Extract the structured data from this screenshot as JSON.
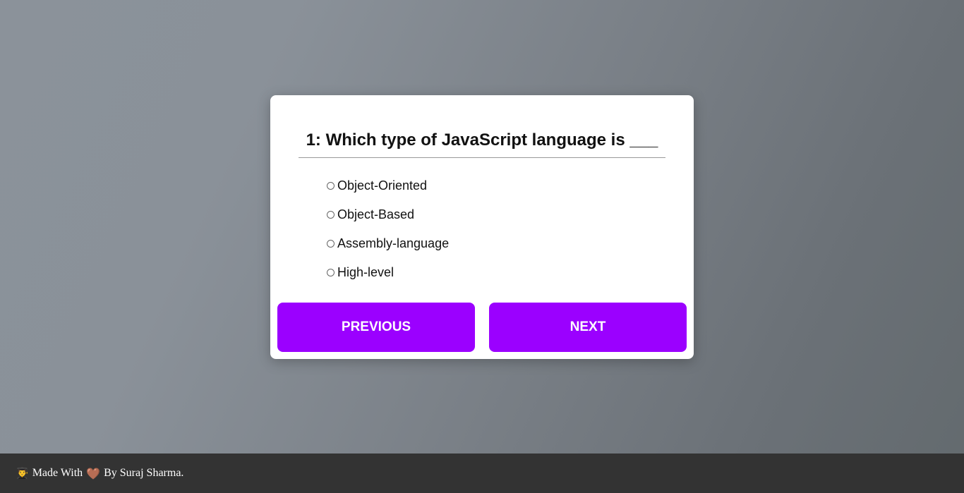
{
  "quiz": {
    "question": "1: Which type of JavaScript language is ___",
    "options": [
      "Object-Oriented",
      "Object-Based",
      "Assembly-language",
      "High-level"
    ],
    "previous_label": "PREVIOUS",
    "next_label": "NEXT"
  },
  "footer": {
    "emoji": "👨‍🎓",
    "made_with": "Made With",
    "heart": "🤎",
    "by": "By Suraj Sharma."
  },
  "colors": {
    "accent": "#9b00ff",
    "footer_bg": "#333333"
  }
}
